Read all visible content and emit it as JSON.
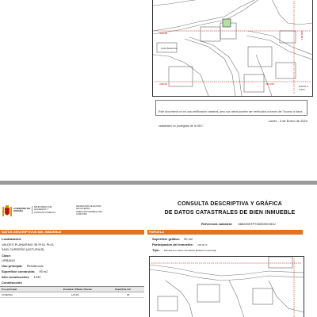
{
  "page1": {
    "disclaimer": "Este documento no es una certificación catastral, pero sus datos pueden ser verificados a través del \"Acceso a datos catastrales no protegidos de la SEC\"",
    "date_line": "Lunes , 3 de Enero de 2022",
    "map_labels": [
      "Avda Bellavista"
    ],
    "coords": [
      "4.80,60",
      "4.80,50",
      "270,700",
      "4.80,000"
    ],
    "scale_label": "ESCALA",
    "scale_value": "1:800"
  },
  "page2": {
    "ministry": {
      "gobierno": "GOBIERNO DE ESPAÑA",
      "ministerio": "MINISTERIO DE HACIENDA Y FUNCIÓN PÚBLICA",
      "secretaria": "SECRETARÍA DE ESTADO DE HACIENDA",
      "direccion": "DIRECCIÓN GENERAL DEL CATASTRO"
    },
    "title_line1": "CONSULTA DESCRIPTIVA Y GRÁFICA",
    "title_line2": "DE DATOS CATASTRALES DE BIEN INMUEBLE",
    "ref_label": "Referencia catastral:",
    "ref_value": "6862805TP7360D0004DU",
    "left_section": "DATOS DESCRIPTIVOS DEL INMUEBLE",
    "localizacion_label": "Localización:",
    "localizacion_l1": "VALDES PLANARINO 35 Pl:01 Pt:01",
    "localizacion_l2": "3460 CARREÑO [ASTURIAS]",
    "clase_label": "Clase:",
    "clase_value": "URBANO",
    "uso_label": "Uso principal:",
    "uso_value": "Residencial",
    "superficie_label": "Superficie construida:",
    "superficie_value": "95 m2",
    "anio_label": "Año construcción:",
    "anio_value": "1949",
    "construccion_label": "Construcción",
    "table_headers": [
      "Uso principal",
      "Escalera / Planta / Puerta",
      "Superficie m2"
    ],
    "table_rows": [
      [
        "VIVIENDA",
        "1/01/01",
        "95"
      ]
    ],
    "right_section": "PARCELA",
    "sup_grafica_label": "Superficie gráfica:",
    "sup_grafica_value": "90 m2",
    "participacion_label": "Participación del inmueble:",
    "participacion_value": "100,00 %",
    "tipo_label": "Tipo:",
    "tipo_value": "Parcela con varios inmuebles [división horizontal]"
  },
  "colors": {
    "accent": "#e3731f",
    "coord_red": "#c00000",
    "parcel_green": "#b6e0a2"
  }
}
